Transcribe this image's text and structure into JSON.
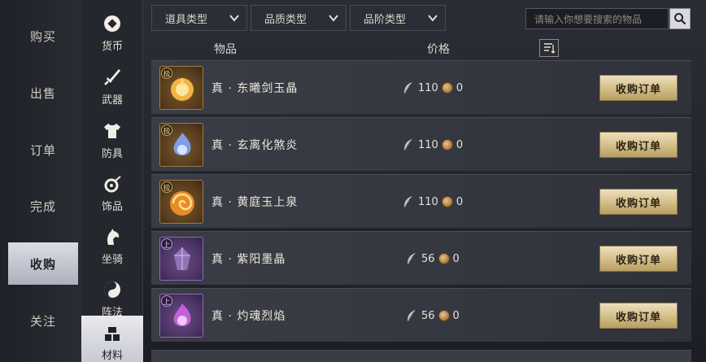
{
  "left_nav": {
    "items": [
      {
        "label": "购买"
      },
      {
        "label": "出售"
      },
      {
        "label": "订单"
      },
      {
        "label": "完成"
      },
      {
        "label": "收购",
        "active": true
      },
      {
        "label": "关注"
      }
    ]
  },
  "categories": {
    "items": [
      {
        "label": "货币",
        "icon": "currency-icon"
      },
      {
        "label": "武器",
        "icon": "sword-icon"
      },
      {
        "label": "防具",
        "icon": "armor-icon"
      },
      {
        "label": "饰品",
        "icon": "accessory-icon"
      },
      {
        "label": "坐骑",
        "icon": "horse-icon"
      },
      {
        "label": "阵法",
        "icon": "formation-icon"
      },
      {
        "label": "材料",
        "icon": "material-icon",
        "active": true
      }
    ]
  },
  "filters": {
    "item_type": "道具类型",
    "quality_type": "品质类型",
    "tier_type": "品阶类型"
  },
  "search": {
    "placeholder": "请输入你想要搜索的物品"
  },
  "table": {
    "col_item": "物品",
    "col_price": "价格"
  },
  "rows": [
    {
      "name": "真 · 东曦剑玉晶",
      "grade": "极",
      "tier": "gold",
      "price": "110",
      "coins": "0",
      "button": "收购订单"
    },
    {
      "name": "真 · 玄离化煞炎",
      "grade": "极",
      "tier": "gold",
      "price": "110",
      "coins": "0",
      "button": "收购订单"
    },
    {
      "name": "真 · 黄庭玉上泉",
      "grade": "极",
      "tier": "gold",
      "price": "110",
      "coins": "0",
      "button": "收购订单"
    },
    {
      "name": "真 · 紫阳墨晶",
      "grade": "上",
      "tier": "purple",
      "price": "56",
      "coins": "0",
      "button": "收购订单"
    },
    {
      "name": "真 · 灼魂烈焰",
      "grade": "上",
      "tier": "purple",
      "price": "56",
      "coins": "0",
      "button": "收购订单"
    }
  ],
  "colors": {
    "gold_button": "#d2bd87",
    "active_nav": "#c9c9d2",
    "gold_border": "#a07b46",
    "purple_border": "#8e6db4"
  }
}
